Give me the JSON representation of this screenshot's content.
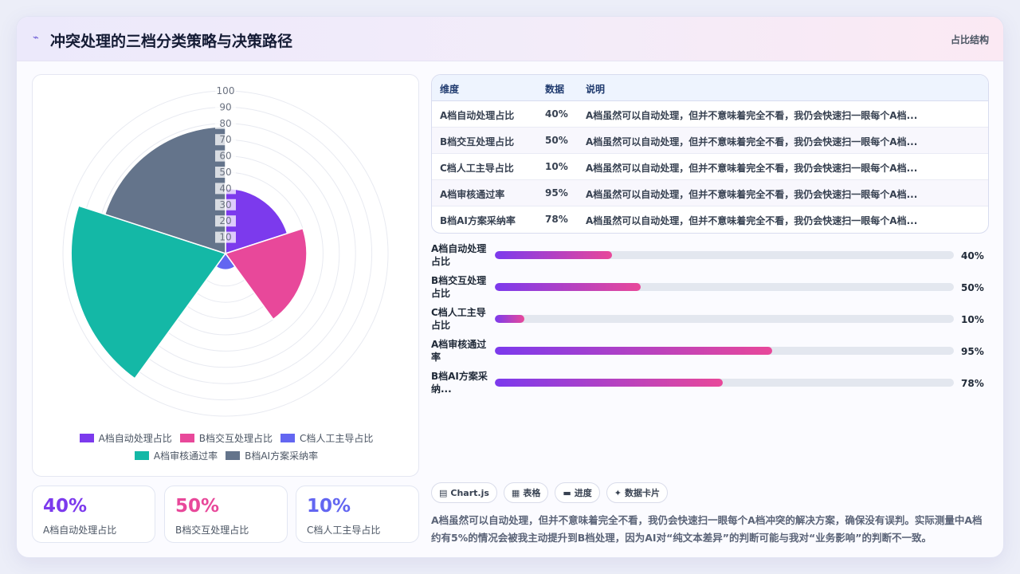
{
  "header": {
    "title": "冲突处理的三档分类策略与决策路径",
    "tag": "占比结构",
    "logo_icon": "sparkline-icon"
  },
  "chart_data": {
    "type": "polarArea",
    "categories": [
      "A档自动处理占比",
      "B档交互处理占比",
      "C档人工主导占比",
      "A档审核通过率",
      "B档AI方案采纳率"
    ],
    "values": [
      40,
      50,
      10,
      95,
      78
    ],
    "colors": [
      "#7c3aed",
      "#e8489a",
      "#6366f1",
      "#14b8a6",
      "#64748b"
    ],
    "rlim": [
      0,
      100
    ],
    "tick_labels": [
      "10",
      "20",
      "30",
      "40",
      "50",
      "60",
      "70",
      "80",
      "90",
      "100"
    ],
    "legend_position": "bottom"
  },
  "legend": {
    "row1": [
      "A档自动处理占比",
      "B档交互处理占比",
      "C档人工主导占比"
    ],
    "row2": [
      "A档审核通过率",
      "B档AI方案采纳率"
    ]
  },
  "stats": [
    {
      "value": "40%",
      "label": "A档自动处理占比",
      "color": "#7c3aed"
    },
    {
      "value": "50%",
      "label": "B档交互处理占比",
      "color": "#e8489a"
    },
    {
      "value": "10%",
      "label": "C档人工主导占比",
      "color": "#6366f1"
    }
  ],
  "table": {
    "headers": [
      "维度",
      "数据",
      "说明"
    ],
    "rows": [
      [
        "A档自动处理占比",
        "40%",
        "A档虽然可以自动处理，但并不意味着完全不看，我仍会快速扫一眼每个A档..."
      ],
      [
        "B档交互处理占比",
        "50%",
        "A档虽然可以自动处理，但并不意味着完全不看，我仍会快速扫一眼每个A档..."
      ],
      [
        "C档人工主导占比",
        "10%",
        "A档虽然可以自动处理，但并不意味着完全不看，我仍会快速扫一眼每个A档..."
      ],
      [
        "A档审核通过率",
        "95%",
        "A档虽然可以自动处理，但并不意味着完全不看，我仍会快速扫一眼每个A档..."
      ],
      [
        "B档AI方案采纳率",
        "78%",
        "A档虽然可以自动处理，但并不意味着完全不看，我仍会快速扫一眼每个A档..."
      ]
    ]
  },
  "bars": [
    {
      "label": "A档自动处理占比",
      "value": 40,
      "pct": "40%"
    },
    {
      "label": "B档交互处理占比",
      "value": 50,
      "pct": "50%"
    },
    {
      "label": "C档人工主导占比",
      "value": 10,
      "pct": "10%"
    },
    {
      "label": "A档审核通过率",
      "value": 95,
      "pct": "95%"
    },
    {
      "label": "B档AI方案采纳...",
      "value": 78,
      "pct": "78%"
    }
  ],
  "chips": [
    {
      "icon": "chart-icon",
      "glyph": "▤",
      "label": "Chart.js"
    },
    {
      "icon": "table-icon",
      "glyph": "▦",
      "label": "表格"
    },
    {
      "icon": "progress-icon",
      "glyph": "▬",
      "label": "进度"
    },
    {
      "icon": "sparkle-icon",
      "glyph": "✦",
      "label": "数据卡片"
    }
  ],
  "note": "A档虽然可以自动处理，但并不意味着完全不看，我仍会快速扫一眼每个A档冲突的解决方案，确保没有误判。实际测量中A档约有5%的情况会被我主动提升到B档处理，因为AI对“纯文本差异”的判断可能与我对“业务影响”的判断不一致。"
}
